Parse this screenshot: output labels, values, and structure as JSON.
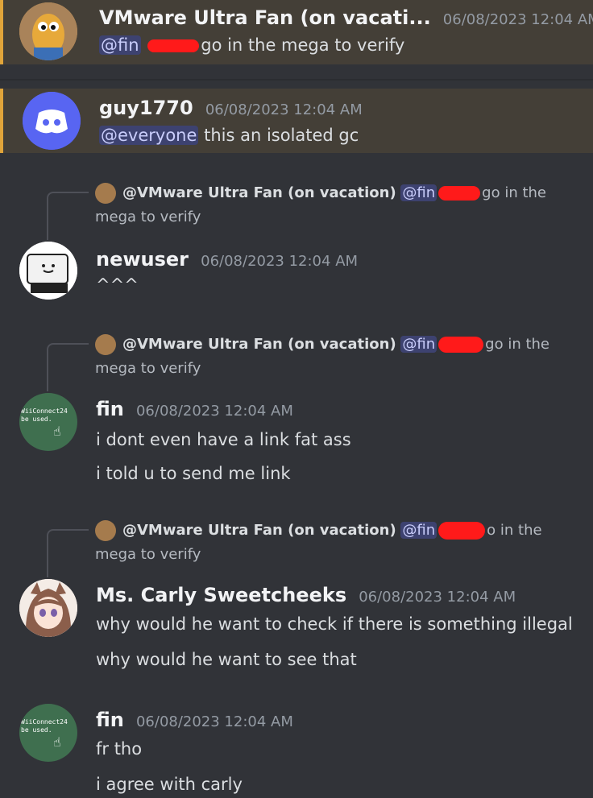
{
  "messages": [
    {
      "username": "VMware Ultra Fan (on vacati...",
      "timestamp": "06/08/2023 12:04 AM",
      "mention": "@fin",
      "text_after": "go in the mega to verify"
    },
    {
      "username": "guy1770",
      "timestamp": "06/08/2023 12:04 AM",
      "mention": "@everyone",
      "text_after": " this an isolated gc"
    },
    {
      "reply_author": "@VMware Ultra Fan (on vacation)",
      "reply_mention": "@fin",
      "reply_tail": "go in the",
      "reply_line2": "mega to verify",
      "username": "newuser",
      "timestamp": "06/08/2023 12:04 AM",
      "text": "^^^"
    },
    {
      "reply_author": "@VMware Ultra Fan (on vacation)",
      "reply_mention": "@fin",
      "reply_tail": "go in the",
      "reply_line2": "mega to verify",
      "username": "fin",
      "timestamp": "06/08/2023 12:04 AM",
      "lines": [
        "i dont even have a link fat ass",
        "i told u to send me link"
      ],
      "avatar_text": [
        "WiiConnect24",
        "be used."
      ]
    },
    {
      "reply_author": "@VMware Ultra Fan (on vacation)",
      "reply_mention": "@fin",
      "reply_tail": "o in the",
      "reply_line2": "mega to verify",
      "username": "Ms. Carly Sweetcheeks",
      "timestamp": "06/08/2023 12:04 AM",
      "lines": [
        "why would he want to check if there is something illegal",
        "why would he want to see that"
      ]
    },
    {
      "username": "fin",
      "timestamp": "06/08/2023 12:04 AM",
      "lines": [
        "fr tho",
        "i agree with carly"
      ],
      "avatar_text": [
        "WiiConnect24",
        "be used."
      ]
    }
  ],
  "colors": {
    "background": "#313338",
    "highlight": "#443f37",
    "highlight_border": "#e0a43a",
    "mention_bg": "#3d4270",
    "redaction": "#ff1a1a"
  }
}
